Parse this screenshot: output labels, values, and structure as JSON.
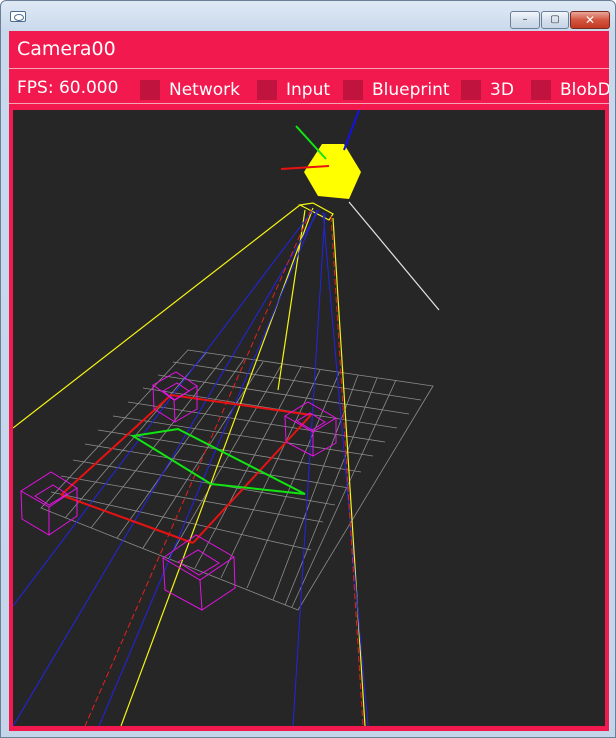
{
  "window": {
    "title": "",
    "controls": {
      "minimize": "–",
      "maximize": "▢",
      "close": "✕"
    }
  },
  "header": {
    "title": "Camera00"
  },
  "toolbar": {
    "fps": "FPS: 60.000",
    "toggles": [
      {
        "label": "Network"
      },
      {
        "label": "Input"
      },
      {
        "label": "Blueprint"
      },
      {
        "label": "3D"
      },
      {
        "label": "BlobDe"
      }
    ]
  },
  "colors": {
    "accent": "#f2194e",
    "toggle_box": "#c0143f",
    "viewport_bg": "#262626"
  },
  "icons": [
    "app-icon",
    "minimize-icon",
    "maximize-icon",
    "close-icon"
  ]
}
